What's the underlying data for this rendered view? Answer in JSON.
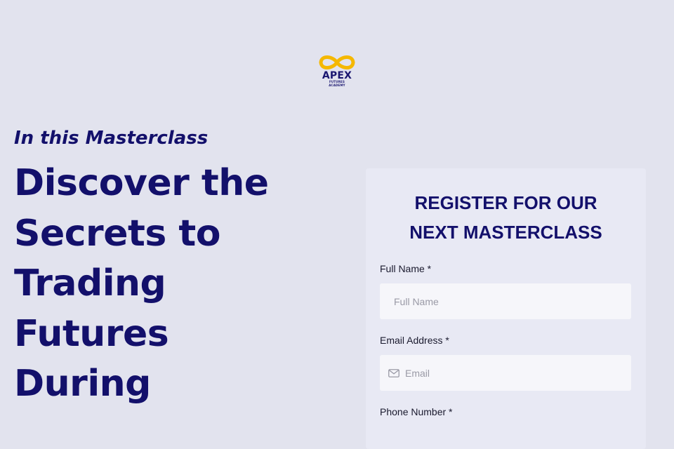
{
  "logo": {
    "wordmark": "APEX",
    "subline_1": "FUTURES",
    "subline_2": "ACADEMY",
    "icon": "infinity-icon",
    "colors": {
      "infinity": "#f5b800",
      "text": "#1a1670"
    }
  },
  "hero": {
    "kicker": "In this Masterclass",
    "headline": "Discover the Secrets to Trading Futures During"
  },
  "form": {
    "title_line_1": "REGISTER FOR OUR",
    "title_line_2": "NEXT MASTERCLASS",
    "full_name": {
      "label": "Full Name *",
      "placeholder": "Full Name",
      "value": ""
    },
    "email": {
      "label": "Email Address *",
      "placeholder": "Email",
      "value": "",
      "icon": "mail-icon"
    },
    "phone": {
      "label": "Phone Number *"
    }
  },
  "colors": {
    "page_background": "#e2e3ee",
    "card_background": "#e8e9f4",
    "brand_navy": "#13106b",
    "brand_gold": "#f5b800",
    "input_background": "#f6f6fa"
  }
}
